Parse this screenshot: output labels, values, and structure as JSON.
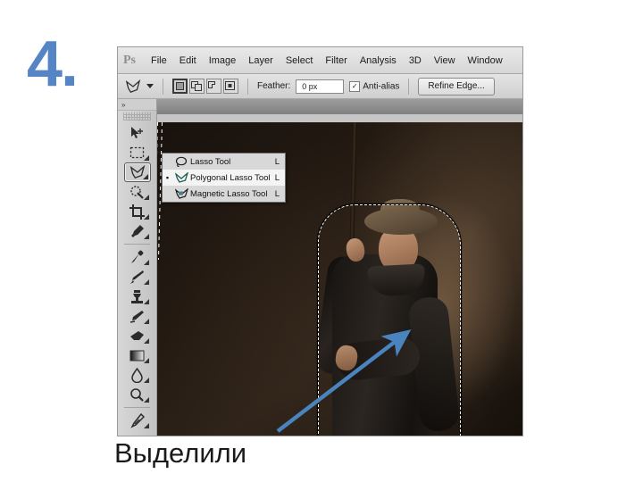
{
  "annotation": {
    "step_number": "4.",
    "step_color": "#5585c5",
    "caption": "Выделили",
    "arrow_color": "#4a84bf"
  },
  "app": {
    "logo": "Ps",
    "menubar": [
      {
        "label": "File"
      },
      {
        "label": "Edit"
      },
      {
        "label": "Image"
      },
      {
        "label": "Layer"
      },
      {
        "label": "Select"
      },
      {
        "label": "Filter"
      },
      {
        "label": "Analysis"
      },
      {
        "label": "3D"
      },
      {
        "label": "View"
      },
      {
        "label": "Window"
      }
    ],
    "options_bar": {
      "tool_icon": "lasso-tool-icon",
      "selection_modes": [
        {
          "name": "new-selection",
          "active": true
        },
        {
          "name": "add-to-selection",
          "active": false
        },
        {
          "name": "subtract-from-selection",
          "active": false
        },
        {
          "name": "intersect-with-selection",
          "active": false
        }
      ],
      "feather_label": "Feather:",
      "feather_value": "0 px",
      "antialias_label": "Anti-alias",
      "antialias_checked": true,
      "antialias_mark": "✓",
      "refine_edge_label": "Refine Edge..."
    },
    "toolbar": {
      "grip": "»",
      "tools": [
        {
          "name": "move-tool",
          "has_flyout": false,
          "selected": false
        },
        {
          "name": "rectangular-marquee-tool",
          "has_flyout": true,
          "selected": false
        },
        {
          "name": "lasso-tool",
          "has_flyout": true,
          "selected": true
        },
        {
          "name": "quick-selection-tool",
          "has_flyout": true,
          "selected": false
        },
        {
          "name": "crop-tool",
          "has_flyout": true,
          "selected": false
        },
        {
          "name": "eyedropper-tool",
          "has_flyout": true,
          "selected": false
        },
        {
          "name": "spot-healing-brush-tool",
          "has_flyout": true,
          "selected": false
        },
        {
          "name": "brush-tool",
          "has_flyout": true,
          "selected": false
        },
        {
          "name": "clone-stamp-tool",
          "has_flyout": true,
          "selected": false
        },
        {
          "name": "history-brush-tool",
          "has_flyout": true,
          "selected": false
        },
        {
          "name": "eraser-tool",
          "has_flyout": true,
          "selected": false
        },
        {
          "name": "gradient-tool",
          "has_flyout": true,
          "selected": false
        },
        {
          "name": "blur-tool",
          "has_flyout": true,
          "selected": false
        },
        {
          "name": "dodge-tool",
          "has_flyout": true,
          "selected": false
        },
        {
          "name": "pen-tool",
          "has_flyout": true,
          "selected": false
        },
        {
          "name": "horizontal-type-tool",
          "has_flyout": true,
          "selected": false
        },
        {
          "name": "path-selection-tool",
          "has_flyout": true,
          "selected": false
        }
      ]
    },
    "flyout_menu": {
      "items": [
        {
          "label": "Lasso Tool",
          "shortcut": "L",
          "active": false,
          "bullet": ""
        },
        {
          "label": "Polygonal Lasso Tool",
          "shortcut": "L",
          "active": true,
          "bullet": "▪"
        },
        {
          "label": "Magnetic Lasso Tool",
          "shortcut": "L",
          "active": false,
          "bullet": ""
        }
      ]
    },
    "canvas": {
      "description": "man-in-hat-climbing-rope-photo",
      "selection": "marching-ants-selection-around-subject"
    }
  }
}
